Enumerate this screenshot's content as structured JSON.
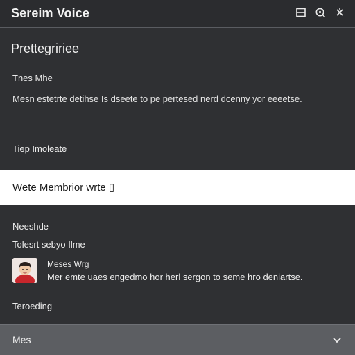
{
  "window": {
    "title": "Sereim Voice",
    "icons": [
      "window-icon",
      "pin-icon",
      "close-icon"
    ]
  },
  "panel": {
    "title": "Prettegririee",
    "field1_label": "Tnes Mhe",
    "description": "Mesn estetrte detihse Is dseete to pe pertesed nerd dcenny yor eeeetse.",
    "field2_label": "Tiep Imoleate",
    "input_value": "Wete Membrior wrte ▯",
    "field3_label": "Neeshde",
    "field4_label": "Tolesrt sebyo Ilme",
    "example": {
      "name": "Meses Wrg",
      "text": "Mer emte uaes engedmo hor herl sergon to seme hro deniartse.",
      "avatar": "avatar-icon"
    },
    "field5_label": "Teroeding"
  },
  "footer": {
    "dropdown_label": "Mes",
    "chevron": "chevron-down-icon"
  },
  "colors": {
    "background": "#2f3033",
    "topbar": "#2b2c2f",
    "input_band": "#ffffff",
    "footer": "#5c5e62",
    "text": "#e9e9e9"
  }
}
